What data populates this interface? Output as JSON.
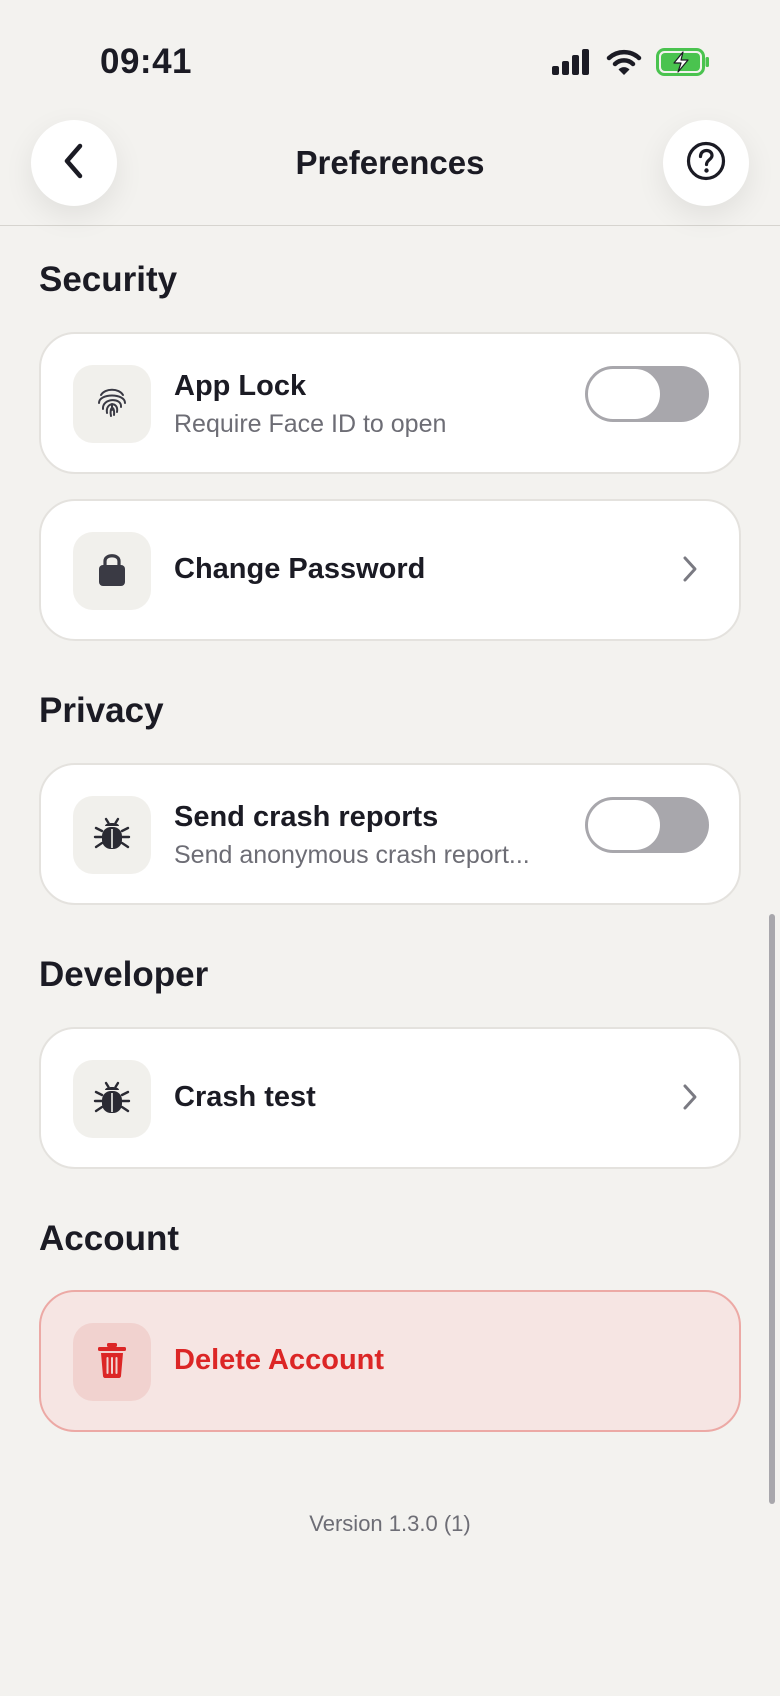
{
  "status_bar": {
    "time": "09:41"
  },
  "header": {
    "title": "Preferences",
    "back_icon": "chevron-left-icon",
    "help_icon": "question-circle-icon"
  },
  "sections": {
    "security": {
      "title": "Security",
      "app_lock": {
        "title": "App Lock",
        "subtitle": "Require Face ID to open",
        "icon": "fingerprint-icon",
        "enabled": false
      },
      "change_password": {
        "title": "Change Password",
        "icon": "lock-icon"
      }
    },
    "privacy": {
      "title": "Privacy",
      "crash_reports": {
        "title": "Send crash reports",
        "subtitle": "Send anonymous crash report...",
        "icon": "bug-icon",
        "enabled": false
      }
    },
    "developer": {
      "title": "Developer",
      "crash_test": {
        "title": "Crash test",
        "icon": "bug-icon"
      }
    },
    "account": {
      "title": "Account",
      "delete_account": {
        "title": "Delete Account",
        "icon": "trash-icon"
      }
    }
  },
  "footer": {
    "version": "Version 1.3.0 (1)"
  },
  "colors": {
    "background": "#f3f2ef",
    "danger": "#dc2626",
    "danger_background": "#f6e5e3",
    "toggle_off": "#a8a7ac",
    "battery_green": "#4ac34f"
  }
}
